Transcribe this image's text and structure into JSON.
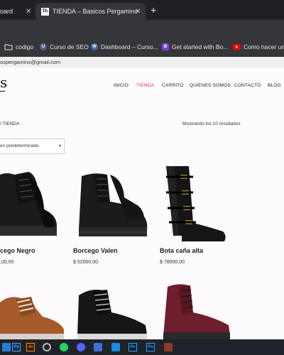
{
  "browser": {
    "tabs": [
      {
        "label": "oard"
      },
      {
        "label": "TIENDA – Basicos Pergamino",
        "favicon": "TA"
      }
    ],
    "new_tab": "+",
    "close": "✕",
    "bookmarks": [
      {
        "label": "codigo",
        "icon": "folder-icon"
      },
      {
        "label": "Curso de SEO",
        "icon": "udemy-icon"
      },
      {
        "label": "Dashboard – Curso...",
        "icon": "wordpress-icon"
      },
      {
        "label": "Get started with Bo...",
        "icon": "bootstrap-icon",
        "icon_text": "B"
      },
      {
        "label": "Como hacer un r",
        "icon": "youtube-icon"
      }
    ]
  },
  "page": {
    "topbar_email": "ospergamino@gmail.com",
    "logo": "s",
    "nav": [
      {
        "label": "INICIO",
        "active": false
      },
      {
        "label": "TIENDA",
        "active": true
      },
      {
        "label": "CARRITO",
        "active": false
      },
      {
        "label": "QUIENES SOMOS",
        "active": false
      },
      {
        "label": "CONTACTO",
        "active": false
      },
      {
        "label": "BLOG",
        "active": false
      }
    ],
    "breadcrumb": "/ TIENDA",
    "results": "Mostrando los 10 resultados",
    "sort": {
      "value": "en predeterminado",
      "caret": "▼"
    },
    "products": [
      {
        "name": "cego Negro",
        "price": ",00,00"
      },
      {
        "name": "Borcego Valen",
        "price": "$ 52000,00"
      },
      {
        "name": "Bota caña alta",
        "price": "$ 78000,00"
      }
    ]
  },
  "colors": {
    "accent": "#d12e6a",
    "chrome_dark": "#202124",
    "chrome_mid": "#35363a",
    "taskbar": "#1f2329"
  },
  "taskbar": {
    "icons": [
      "windows-icon",
      "powerpoint-icon",
      "illustrator-icon",
      "chrome-icon",
      "whatsapp-icon",
      "discord-icon",
      "mail-icon",
      "vscode-icon",
      "photoshop-icon",
      "photoshop-icon",
      "git-icon"
    ],
    "labels": {
      "pp": "Ps",
      "ai": "Ai",
      "ps": "Ps"
    }
  }
}
